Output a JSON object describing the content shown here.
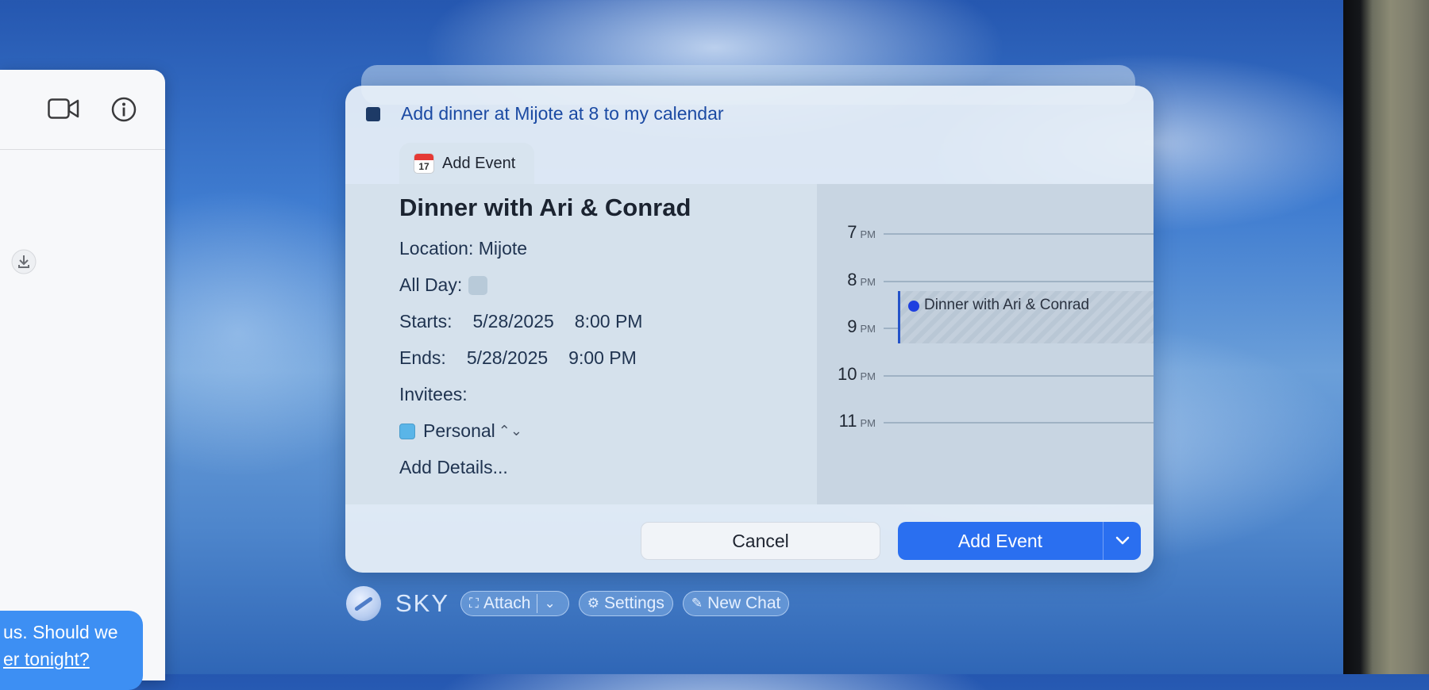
{
  "assistant": {
    "prompt": "Add dinner at Mijote at 8 to my calendar",
    "tab_label": "Add Event",
    "tab_icon_day": "17"
  },
  "event": {
    "title": "Dinner with Ari & Conrad",
    "location_label": "Location:",
    "location": "Mijote",
    "all_day_label": "All Day:",
    "all_day": false,
    "starts_label": "Starts:",
    "start_date": "5/28/2025",
    "start_time": "8:00 PM",
    "ends_label": "Ends:",
    "end_date": "5/28/2025",
    "end_time": "9:00 PM",
    "invitees_label": "Invitees:",
    "calendar": "Personal",
    "add_details": "Add Details..."
  },
  "day_view": {
    "hours": [
      {
        "h": "7",
        "ampm": "PM"
      },
      {
        "h": "8",
        "ampm": "PM"
      },
      {
        "h": "9",
        "ampm": "PM"
      },
      {
        "h": "10",
        "ampm": "PM"
      },
      {
        "h": "11",
        "ampm": "PM"
      }
    ],
    "event_title": "Dinner with Ari & Conrad"
  },
  "buttons": {
    "cancel": "Cancel",
    "add_event": "Add Event"
  },
  "toolbar": {
    "app_name": "SKY",
    "attach": "Attach",
    "settings": "Settings",
    "new_chat": "New Chat"
  },
  "messages": {
    "bubble_line1": "us. Should we",
    "bubble_line2": "er tonight?"
  },
  "colors": {
    "accent": "#2a6ff0",
    "calendar_personal": "#5ab5e8",
    "event_dot": "#1e3fe0"
  }
}
